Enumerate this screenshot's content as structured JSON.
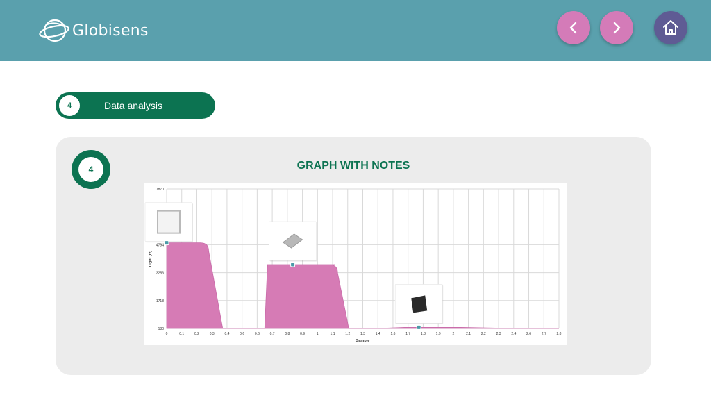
{
  "brand": {
    "name": "Globisens"
  },
  "nav": {
    "prev_icon": "chevron-left-icon",
    "next_icon": "chevron-right-icon",
    "home_icon": "home-icon"
  },
  "step": {
    "number": "4",
    "title": "Data analysis"
  },
  "card": {
    "badge_number": "4",
    "title": "GRAPH WITH NOTES"
  },
  "colors": {
    "header": "#5aa0ad",
    "accent_green": "#0c7351",
    "nav_pink": "#d47bb8",
    "home_purple": "#5f5b94",
    "series": "#d67bb5"
  },
  "chart_data": {
    "type": "area",
    "xlabel": "Sample",
    "ylabel": "Light (lx)",
    "ylim": [
      180,
      7870
    ],
    "xlim": [
      0,
      2.8
    ],
    "y_ticks": [
      "7870",
      "4794",
      "3256",
      "1718",
      "180"
    ],
    "y_tick_values": [
      7870,
      4794,
      3256,
      1718,
      180
    ],
    "x_ticks": [
      "0",
      "0.1",
      "0.2",
      "0.3",
      "0.4",
      "0.6",
      "0.6",
      "0.7",
      "0.8",
      "0.9",
      "1",
      "1.1",
      "1.2",
      "1.3",
      "1.4",
      "1.6",
      "1.7",
      "1.8",
      "1.9",
      "2",
      "2.1",
      "2.2",
      "2.3",
      "2.4",
      "2.6",
      "2.7",
      "2.8"
    ],
    "grid": true,
    "series": [
      {
        "x": [
          0,
          0.01,
          0.3,
          0.4,
          0.6,
          0.7,
          0.72,
          1.2,
          1.22,
          1.3,
          1.4,
          1.5,
          1.7,
          2.1,
          2.5,
          2.8
        ],
        "values": [
          4900,
          4900,
          4900,
          180,
          180,
          180,
          3700,
          3700,
          3700,
          180,
          180,
          180,
          240,
          240,
          180,
          180
        ]
      }
    ],
    "notes": [
      {
        "x": 0,
        "y": 4900,
        "icon": "white-paper-icon"
      },
      {
        "x": 0.9,
        "y": 3700,
        "icon": "foil-sheet-icon"
      },
      {
        "x": 1.8,
        "y": 240,
        "icon": "black-paper-icon"
      }
    ]
  }
}
